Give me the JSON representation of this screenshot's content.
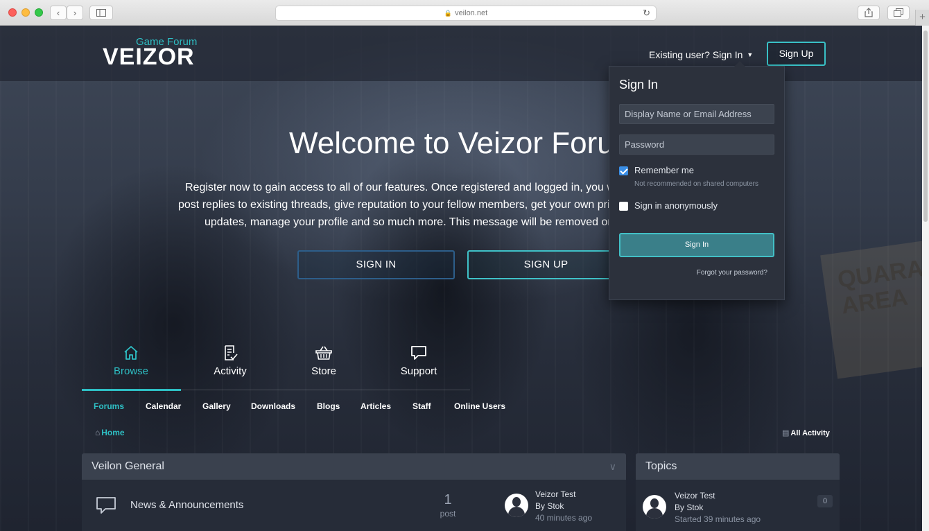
{
  "browser": {
    "url": "veilon.net"
  },
  "header": {
    "logo_sub": "Game Forum",
    "logo_main": "VEIZOR",
    "existing_user": "Existing user? Sign In",
    "signup_button": "Sign Up"
  },
  "hero": {
    "title": "Welcome to Veizor Foru",
    "intro_line1": "Register now to gain access to all of our features. Once registered and logged in, you w",
    "intro_line2": "post replies to existing threads, give reputation to your fellow members, get your own priv",
    "intro_line3": "updates, manage your profile and so much more. This message will be removed on",
    "sign_in_button": "SIGN IN",
    "sign_up_button": "SIGN UP",
    "background_text": "QUARANTINE AREA"
  },
  "nav": {
    "tabs": [
      {
        "label": "Browse",
        "icon": "home-icon",
        "active": true
      },
      {
        "label": "Activity",
        "icon": "activity-icon",
        "active": false
      },
      {
        "label": "Store",
        "icon": "basket-icon",
        "active": false
      },
      {
        "label": "Support",
        "icon": "chat-icon",
        "active": false
      }
    ],
    "subnav": [
      "Forums",
      "Calendar",
      "Gallery",
      "Downloads",
      "Blogs",
      "Articles",
      "Staff",
      "Online Users"
    ]
  },
  "breadcrumb": {
    "home": "Home",
    "all_activity": "All Activity"
  },
  "forum_panel": {
    "title": "Veilon General",
    "forum": {
      "name": "News & Announcements",
      "count": "1",
      "count_label": "post",
      "last_title": "Veizor Test",
      "last_by": "By Stok",
      "last_time": "40 minutes ago"
    }
  },
  "topics_panel": {
    "title": "Topics",
    "topic": {
      "title": "Veizor Test",
      "by": "By Stok",
      "started": "Started 39 minutes ago",
      "replies": "0"
    }
  },
  "signin_dropdown": {
    "title": "Sign In",
    "name_placeholder": "Display Name or Email Address",
    "password_placeholder": "Password",
    "remember_label": "Remember me",
    "remember_note": "Not recommended on shared computers",
    "remember_checked": true,
    "anon_label": "Sign in anonymously",
    "anon_checked": false,
    "submit": "Sign In",
    "forgot": "Forgot your password?"
  },
  "colors": {
    "accent": "#2ebfc4",
    "checkbox": "#3a8ee6",
    "panel_bg": "#2f3542"
  }
}
